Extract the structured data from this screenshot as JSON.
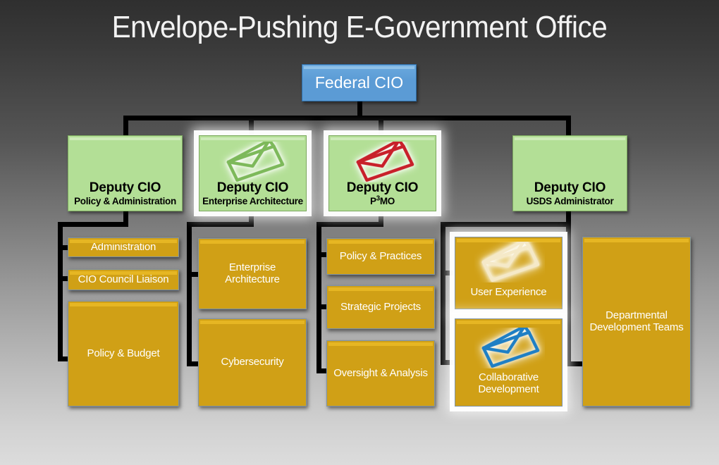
{
  "slide": {
    "title": "Envelope-Pushing E-Government Office",
    "background": {
      "top": "#2f2f2f",
      "bottom": "#dcdcdc"
    }
  },
  "colors": {
    "executive_box": "#5b9bd5",
    "deputy_box": "#b3df96",
    "unit_box": "#d0a016",
    "connector": "#000000",
    "title_text": "#f2f2f2",
    "envelope_green": "#7db95a",
    "envelope_red": "#c8202a",
    "envelope_cream": "#f5e9c8",
    "envelope_blue": "#1f7fc4"
  },
  "org_chart": {
    "type": "org-chart",
    "root": {
      "label": "Federal CIO",
      "level": 0
    },
    "deputies": [
      {
        "title": "Deputy CIO",
        "subtitle": "Policy & Administration",
        "icon": null,
        "highlighted": false,
        "units": [
          {
            "label": "Administration"
          },
          {
            "label": "CIO Council Liaison"
          },
          {
            "label": "Policy & Budget"
          }
        ]
      },
      {
        "title": "Deputy CIO",
        "subtitle": "Enterprise Architecture",
        "icon": "envelope-icon-green",
        "highlighted": true,
        "units": [
          {
            "label": "Enterprise Architecture"
          },
          {
            "label": "Cybersecurity"
          }
        ]
      },
      {
        "title": "Deputy CIO",
        "subtitle_prefix": "P",
        "subtitle_superscript": "3",
        "subtitle_suffix": "MO",
        "subtitle": "P3MO",
        "icon": "envelope-icon-red",
        "highlighted": true,
        "units": [
          {
            "label": "Policy & Practices"
          },
          {
            "label": "Strategic Projects"
          },
          {
            "label": "Oversight & Analysis"
          }
        ]
      },
      {
        "title": "Deputy CIO",
        "subtitle": "USDS Administrator",
        "icon": null,
        "highlighted": false,
        "units": [
          {
            "label": "User Experience",
            "icon": "envelope-icon-cream",
            "highlighted": true
          },
          {
            "label": "Collaborative Development",
            "icon": "envelope-icon-blue",
            "highlighted": true
          },
          {
            "label": "Departmental Development Teams",
            "icon": null,
            "highlighted": false
          }
        ]
      }
    ]
  }
}
